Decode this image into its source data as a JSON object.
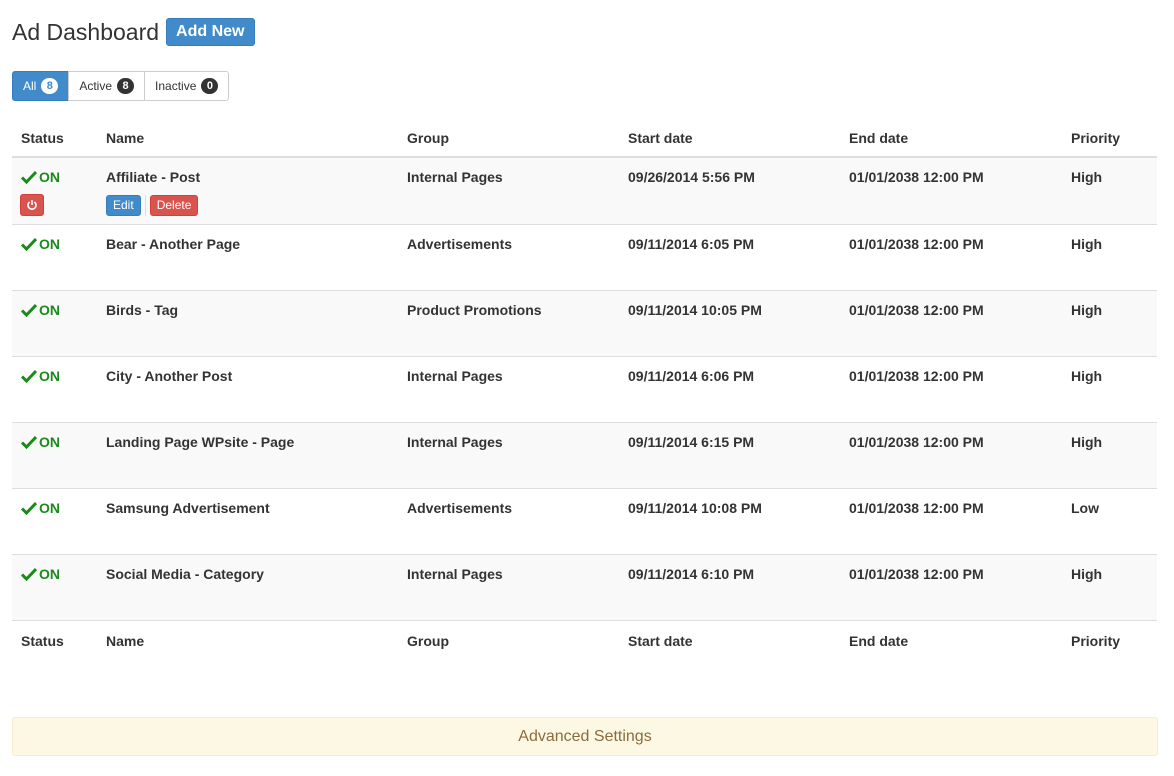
{
  "header": {
    "title": "Ad Dashboard",
    "add_new_label": "Add New"
  },
  "filters": [
    {
      "label": "All",
      "count": "8",
      "active": true
    },
    {
      "label": "Active",
      "count": "8",
      "active": false
    },
    {
      "label": "Inactive",
      "count": "0",
      "active": false
    }
  ],
  "columns": {
    "status": "Status",
    "name": "Name",
    "group": "Group",
    "start": "Start date",
    "end": "End date",
    "priority": "Priority"
  },
  "row_actions": {
    "edit_label": "Edit",
    "delete_label": "Delete",
    "power_icon": "power-icon"
  },
  "rows": [
    {
      "status": "ON",
      "name": "Affiliate - Post",
      "group": "Internal Pages",
      "start": "09/26/2014 5:56 PM",
      "end": "01/01/2038 12:00 PM",
      "priority": "High"
    },
    {
      "status": "ON",
      "name": "Bear - Another Page",
      "group": "Advertisements",
      "start": "09/11/2014 6:05 PM",
      "end": "01/01/2038 12:00 PM",
      "priority": "High"
    },
    {
      "status": "ON",
      "name": "Birds - Tag",
      "group": "Product Promotions",
      "start": "09/11/2014 10:05 PM",
      "end": "01/01/2038 12:00 PM",
      "priority": "High"
    },
    {
      "status": "ON",
      "name": "City - Another Post",
      "group": "Internal Pages",
      "start": "09/11/2014 6:06 PM",
      "end": "01/01/2038 12:00 PM",
      "priority": "High"
    },
    {
      "status": "ON",
      "name": "Landing Page WPsite - Page",
      "group": "Internal Pages",
      "start": "09/11/2014 6:15 PM",
      "end": "01/01/2038 12:00 PM",
      "priority": "High"
    },
    {
      "status": "ON",
      "name": "Samsung Advertisement",
      "group": "Advertisements",
      "start": "09/11/2014 10:08 PM",
      "end": "01/01/2038 12:00 PM",
      "priority": "Low"
    },
    {
      "status": "ON",
      "name": "Social Media - Category",
      "group": "Internal Pages",
      "start": "09/11/2014 6:10 PM",
      "end": "01/01/2038 12:00 PM",
      "priority": "High"
    }
  ],
  "advanced_settings_label": "Advanced Settings",
  "colors": {
    "primary": "#428bca",
    "danger": "#d9534f",
    "success": "#1a8a1a",
    "warning_bg": "#fcf8e3",
    "warning_text": "#8a6d3b"
  }
}
